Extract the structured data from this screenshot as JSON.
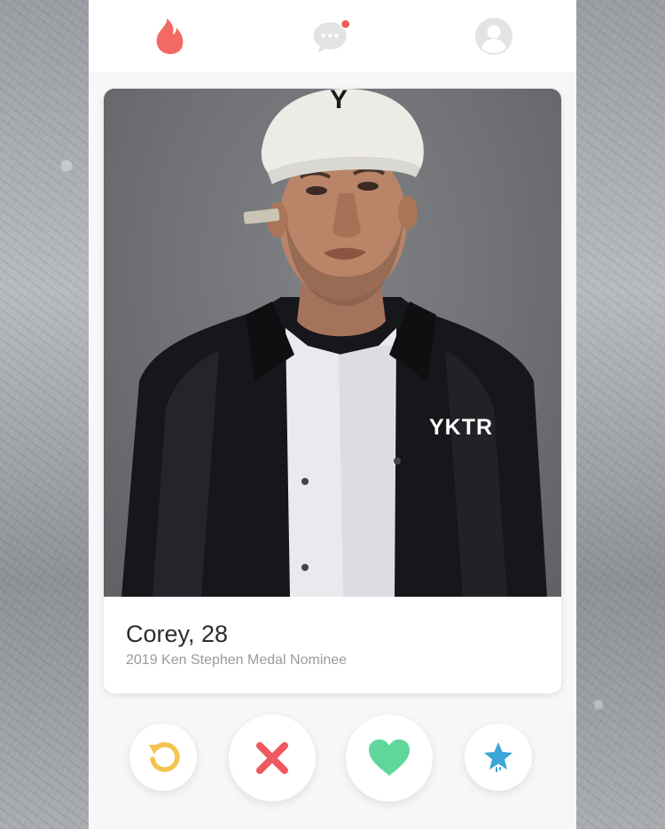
{
  "header": {
    "icons": [
      {
        "name": "flame-icon",
        "color": "#f26a63"
      },
      {
        "name": "messages-icon",
        "color": "#e3e3e3",
        "badge_color": "#f15b5b"
      },
      {
        "name": "profile-icon",
        "color": "#e3e3e3"
      }
    ]
  },
  "profile": {
    "name_age": "Corey, 28",
    "subtitle": "2019 Ken Stephen Medal Nominee",
    "cap_letter": "Y",
    "jacket_text": "YKTR"
  },
  "actions": [
    {
      "name": "rewind-icon",
      "color": "#f3c44f"
    },
    {
      "name": "nope-icon",
      "color": "#f0595f"
    },
    {
      "name": "like-icon",
      "color": "#5fd69a"
    },
    {
      "name": "super-like-icon",
      "color": "#3ba5d8"
    }
  ]
}
